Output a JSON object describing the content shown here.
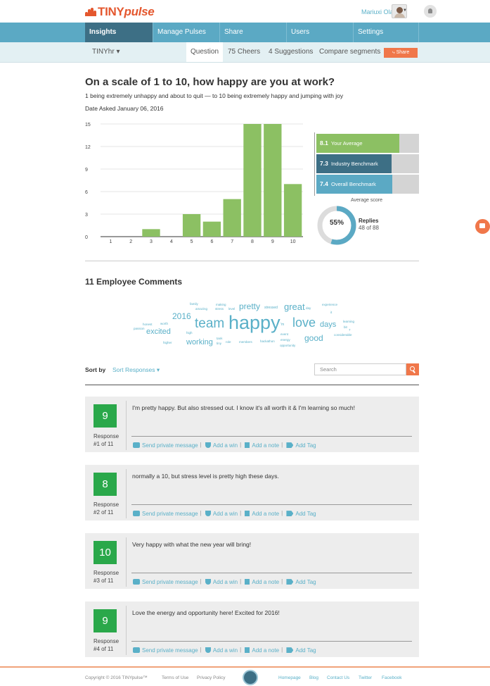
{
  "header": {
    "logo_prefix": "TINY",
    "logo_suffix": "pulse",
    "user_name": "Mariuxi Olaya"
  },
  "main_nav": [
    "Insights",
    "Manage Pulses",
    "Share",
    "Users",
    "Settings"
  ],
  "sub_nav": {
    "org": "TINYhr",
    "tabs": [
      "Question",
      "75 Cheers",
      "4 Suggestions",
      "Compare segments"
    ],
    "share_label": "Share"
  },
  "question": {
    "title": "On a scale of 1 to 10, how happy are you at work?",
    "subtitle": "1 being extremely unhappy and about to quit — to 10 being extremely happy and jumping with joy",
    "date": "Date Asked January 06, 2016"
  },
  "chart_data": {
    "type": "bar",
    "categories": [
      "1",
      "2",
      "3",
      "4",
      "5",
      "6",
      "7",
      "8",
      "9",
      "10"
    ],
    "values": [
      0,
      0,
      1,
      0,
      3,
      2,
      5,
      15,
      15,
      7
    ],
    "y_ticks": [
      "0",
      "3",
      "6",
      "9",
      "12",
      "15"
    ],
    "ylim": [
      0,
      15
    ],
    "grid": "horizontal",
    "bar_color": "#8cc063"
  },
  "benchmarks": [
    {
      "value": "8.1",
      "label": "Your Average",
      "fraction": 0.81,
      "color": "#8cc063"
    },
    {
      "value": "7.3",
      "label": "Industry Benchmark",
      "fraction": 0.73,
      "color": "#3d6f85"
    },
    {
      "value": "7.4",
      "label": "Overall Benchmark",
      "fraction": 0.74,
      "color": "#5ba9c4"
    }
  ],
  "average_label": "Average score",
  "replies": {
    "percent": "55%",
    "fraction": 0.55,
    "title": "Replies",
    "count": "48 of 88"
  },
  "comments": {
    "title": "11 Employee Comments",
    "cloud": [
      "family",
      "making",
      "amazing",
      "stress",
      "level",
      "pretty",
      "stressed",
      "great",
      "day",
      "experience",
      "it",
      "2016",
      "honest",
      "worth",
      "team",
      "happy",
      "'m",
      "love",
      "days",
      "learning",
      "bit",
      "passion",
      "excited",
      "high",
      "event",
      "energy",
      "good",
      "considerable",
      "higher",
      "working",
      "tank",
      "tiny",
      "role",
      "members",
      "hackathon",
      "opportunity",
      "7"
    ],
    "sort_label": "Sort by",
    "sort_value": "Sort Responses",
    "search_placeholder": "Search"
  },
  "responses": [
    {
      "score": "9",
      "label": "Response",
      "index": "#1 of 11",
      "text": "I'm pretty happy. But also stressed out. I know it's all worth it & I'm learning so much!"
    },
    {
      "score": "8",
      "label": "Response",
      "index": "#2 of 11",
      "text": "normally a 10, but stress level is pretty high these days."
    },
    {
      "score": "10",
      "label": "Response",
      "index": "#3 of 11",
      "text": "Very happy with what the new year will bring!"
    },
    {
      "score": "9",
      "label": "Response",
      "index": "#4 of 11",
      "text": "Love the energy and opportunity here! Excited for 2016!"
    }
  ],
  "actions": {
    "message": "Send private message",
    "win": "Add a win",
    "note": "Add a note",
    "tag": "Add Tag"
  },
  "footer": {
    "copyright": "Copyright © 2016 TINYpulse™",
    "terms": "Terms of Use",
    "privacy": "Privacy Policy",
    "homepage": "Homepage",
    "blog": "Blog",
    "contact": "Contact Us",
    "twitter": "Twitter",
    "facebook": "Facebook"
  }
}
